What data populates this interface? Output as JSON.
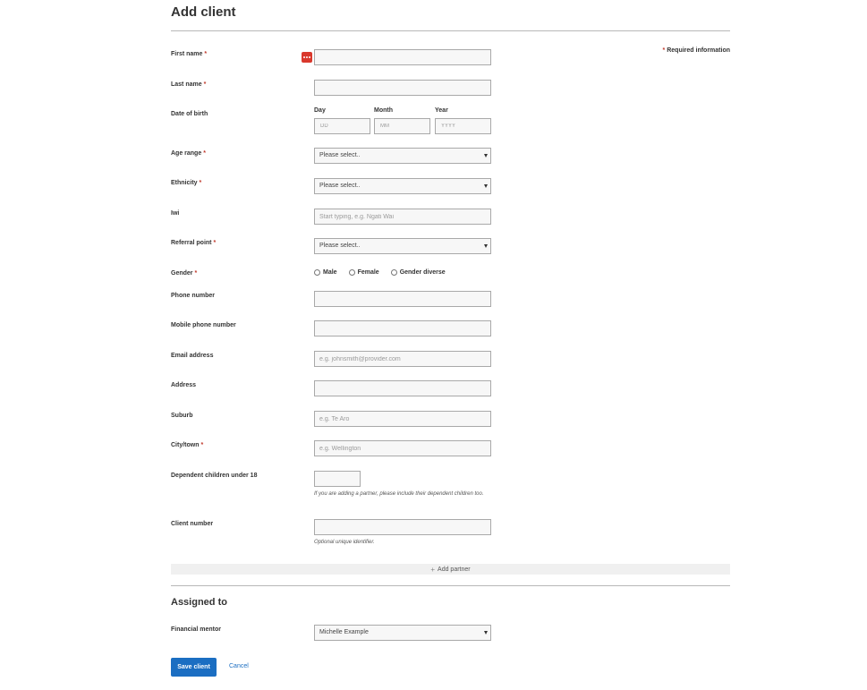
{
  "title": "Add client",
  "required_note": "Required information",
  "required_marker": "*",
  "fields": {
    "first_name": {
      "label": "First name",
      "value": ""
    },
    "last_name": {
      "label": "Last name",
      "value": ""
    },
    "date_of_birth": {
      "label": "Date of birth",
      "day": {
        "label": "Day",
        "placeholder": "DD"
      },
      "month": {
        "label": "Month",
        "placeholder": "MM"
      },
      "year": {
        "label": "Year",
        "placeholder": "YYYY"
      }
    },
    "age_range": {
      "label": "Age range",
      "selected": "Please select.."
    },
    "ethnicity": {
      "label": "Ethnicity",
      "selected": "Please select.."
    },
    "iwi": {
      "label": "Iwi",
      "placeholder": "Start typing, e.g. Ngati Wai"
    },
    "referral_point": {
      "label": "Referral point",
      "selected": "Please select.."
    },
    "gender": {
      "label": "Gender",
      "options": [
        "Male",
        "Female",
        "Gender diverse"
      ]
    },
    "phone_number": {
      "label": "Phone number",
      "value": ""
    },
    "mobile_phone_number": {
      "label": "Mobile phone number",
      "value": ""
    },
    "email_address": {
      "label": "Email address",
      "placeholder": "e.g. johnsmith@provider.com"
    },
    "address": {
      "label": "Address",
      "value": ""
    },
    "suburb": {
      "label": "Suburb",
      "placeholder": "e.g. Te Aro"
    },
    "city_town": {
      "label": "City/town",
      "placeholder": "e.g. Wellington"
    },
    "dependent_children": {
      "label": "Dependent children under 18",
      "hint": "If you are adding a partner, please include their dependent children too."
    },
    "client_number": {
      "label": "Client number",
      "hint": "Optional unique identifier."
    }
  },
  "add_partner_label": "Add partner",
  "assigned_to": {
    "title": "Assigned to",
    "financial_mentor": {
      "label": "Financial mentor",
      "selected": "Michelle Example"
    }
  },
  "actions": {
    "save_label": "Save client",
    "cancel_label": "Cancel"
  },
  "colors": {
    "primary": "#1b6ec2",
    "required": "#c0392b",
    "password_manager_icon": "#d9382c"
  }
}
